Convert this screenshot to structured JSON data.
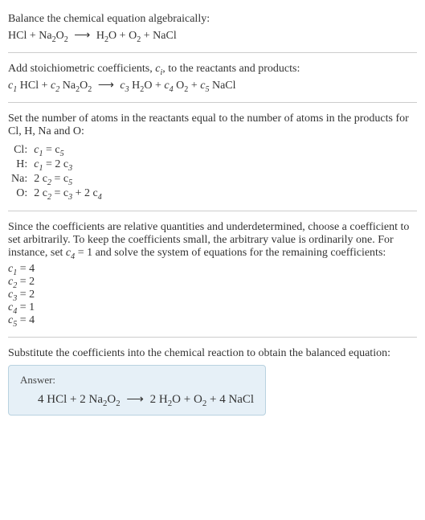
{
  "chart_data": {
    "type": "table",
    "title": "Balancing HCl + Na2O2 → H2O + O2 + NaCl",
    "reactants": [
      "HCl",
      "Na2O2"
    ],
    "products": [
      "H2O",
      "O2",
      "NaCl"
    ],
    "coefficient_vars": [
      "c1",
      "c2",
      "c3",
      "c4",
      "c5"
    ],
    "atom_balance": [
      {
        "element": "Cl",
        "equation": "c1 = c5"
      },
      {
        "element": "H",
        "equation": "c1 = 2 c3"
      },
      {
        "element": "Na",
        "equation": "2 c2 = c5"
      },
      {
        "element": "O",
        "equation": "2 c2 = c3 + 2 c4"
      }
    ],
    "arbitrary_set": {
      "var": "c4",
      "value": 1
    },
    "solution": {
      "c1": 4,
      "c2": 2,
      "c3": 2,
      "c4": 1,
      "c5": 4
    },
    "balanced_equation": "4 HCl + 2 Na2O2 → 2 H2O + O2 + 4 NaCl"
  },
  "s1": {
    "line1": "Balance the chemical equation algebraically:"
  },
  "s2": {
    "line1_a": "Add stoichiometric coefficients, ",
    "line1_b": ", to the reactants and products:"
  },
  "s3": {
    "intro": "Set the number of atoms in the reactants equal to the number of atoms in the products for Cl, H, Na and O:",
    "rows": [
      {
        "el": "Cl:",
        "eq_prefix": "c",
        "eq": "1",
        "eq_mid": " = c",
        "eq_r": "5"
      },
      {
        "el": "H:",
        "eq": "1",
        "eq_mid": " = 2 c",
        "eq_r": "3"
      },
      {
        "el": "Na:",
        "eq_prefix2": "2 c",
        "eq": "2",
        "eq_mid": " = c",
        "eq_r": "5"
      },
      {
        "el": "O:",
        "eq_prefix2": "2 c",
        "eq": "2",
        "eq_mid": " = c",
        "eq_r": "3",
        "tail": " + 2 c",
        "tail_r": "4"
      }
    ]
  },
  "s4": {
    "para_a": "Since the coefficients are relative quantities and underdetermined, choose a coefficient to set arbitrarily. To keep the coefficients small, the arbitrary value is ordinarily one. For instance, set ",
    "para_b": " = 1 and solve the system of equations for the remaining coefficients:",
    "lines": [
      {
        "v": "1",
        "val": " = 4"
      },
      {
        "v": "2",
        "val": " = 2"
      },
      {
        "v": "3",
        "val": " = 2"
      },
      {
        "v": "4",
        "val": " = 1"
      },
      {
        "v": "5",
        "val": " = 4"
      }
    ]
  },
  "s5": {
    "intro": "Substitute the coefficients into the chemical reaction to obtain the balanced equation:",
    "answer_label": "Answer:"
  },
  "chem": {
    "HCl": "HCl",
    "Na2O2_a": "Na",
    "Na2O2_b": "2",
    "Na2O2_c": "O",
    "Na2O2_d": "2",
    "H2O_a": "H",
    "H2O_b": "2",
    "H2O_c": "O",
    "O2_a": "O",
    "O2_b": "2",
    "NaCl": "NaCl",
    "arrow": "⟶",
    "plus": " + ",
    "c": "c",
    "i": "i",
    "n4": "4 ",
    "n2": "2 ",
    "sub4": "4"
  }
}
